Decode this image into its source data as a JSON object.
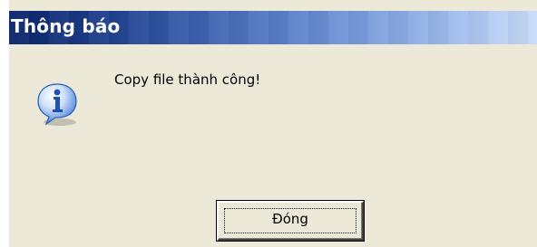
{
  "dialog": {
    "title": "Thông báo",
    "message": "Copy file thành công!",
    "icon": "info-icon",
    "button_label": "Đóng"
  },
  "colors": {
    "title_bar_start": "#0a246a",
    "title_bar_end": "#c9dcf8",
    "dialog_background": "#ece9d8",
    "icon_blue": "#2f6fd0"
  }
}
